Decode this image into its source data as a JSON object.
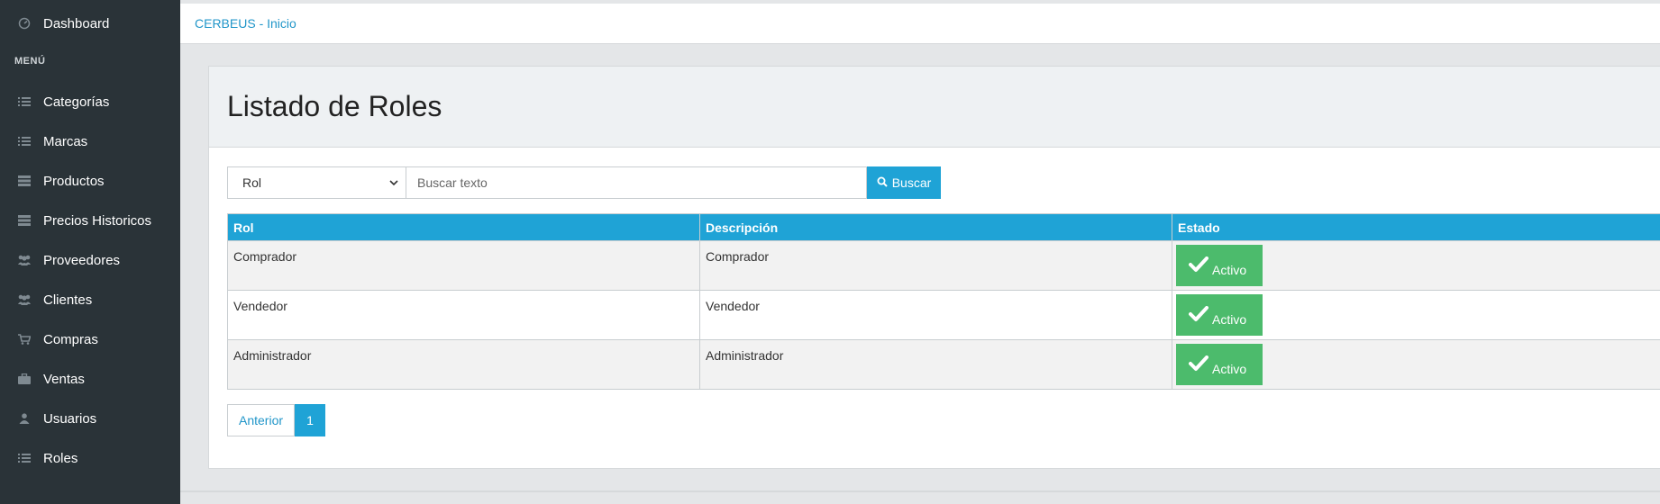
{
  "sidebar": {
    "dashboard": {
      "label": "Dashboard",
      "icon": "dashboard-icon"
    },
    "menu_header": "MENÚ",
    "items": [
      {
        "label": "Categorías",
        "icon": "list-icon"
      },
      {
        "label": "Marcas",
        "icon": "list-icon"
      },
      {
        "label": "Productos",
        "icon": "stack-icon"
      },
      {
        "label": "Precios Historicos",
        "icon": "stack-icon"
      },
      {
        "label": "Proveedores",
        "icon": "users-icon"
      },
      {
        "label": "Clientes",
        "icon": "users-icon"
      },
      {
        "label": "Compras",
        "icon": "cart-icon"
      },
      {
        "label": "Ventas",
        "icon": "briefcase-icon"
      },
      {
        "label": "Usuarios",
        "icon": "user-icon"
      },
      {
        "label": "Roles",
        "icon": "list-icon"
      }
    ]
  },
  "topbar": {
    "breadcrumb": "CERBEUS - Inicio"
  },
  "page": {
    "title": "Listado de Roles"
  },
  "search": {
    "select_value": "Rol",
    "placeholder": "Buscar texto",
    "button_label": "Buscar"
  },
  "table": {
    "headers": [
      "Rol",
      "Descripción",
      "Estado"
    ],
    "rows": [
      {
        "rol": "Comprador",
        "descripcion": "Comprador",
        "estado": "Activo"
      },
      {
        "rol": "Vendedor",
        "descripcion": "Vendedor",
        "estado": "Activo"
      },
      {
        "rol": "Administrador",
        "descripcion": "Administrador",
        "estado": "Activo"
      }
    ]
  },
  "pagination": {
    "prev_label": "Anterior",
    "current_page": "1"
  },
  "colors": {
    "sidebar_bg": "#2a3338",
    "accent": "#1fa3d6",
    "success": "#4cbb6c"
  }
}
